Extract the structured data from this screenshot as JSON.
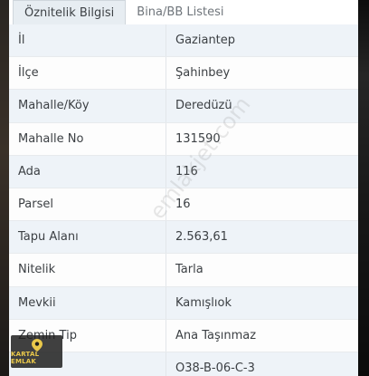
{
  "tabs": [
    {
      "label": "Öznitelik Bilgisi",
      "active": true
    },
    {
      "label": "Bina/BB Listesi",
      "active": false
    }
  ],
  "rows": [
    {
      "key": "İl",
      "value": "Gaziantep"
    },
    {
      "key": "İlçe",
      "value": "Şahinbey"
    },
    {
      "key": "Mahalle/Köy",
      "value": "Deredüzü"
    },
    {
      "key": "Mahalle No",
      "value": "131590"
    },
    {
      "key": "Ada",
      "value": "116"
    },
    {
      "key": "Parsel",
      "value": "16"
    },
    {
      "key": "Tapu Alanı",
      "value": "2.563,61"
    },
    {
      "key": "Nitelik",
      "value": "Tarla"
    },
    {
      "key": "Mevkii",
      "value": "Kamışlıok"
    },
    {
      "key": "Zemin Tip",
      "value": "Ana Taşınmaz"
    },
    {
      "key": "",
      "value": "O38-B-06-C-3"
    }
  ],
  "watermark": "emlakjet.com",
  "logo": {
    "text": "KARTAL EMLAK",
    "accent_color": "#e9c84a"
  },
  "colors": {
    "row_odd": "#eef3f8",
    "row_even": "#fdfdfd",
    "tab_active_bg": "#e7edf2"
  }
}
